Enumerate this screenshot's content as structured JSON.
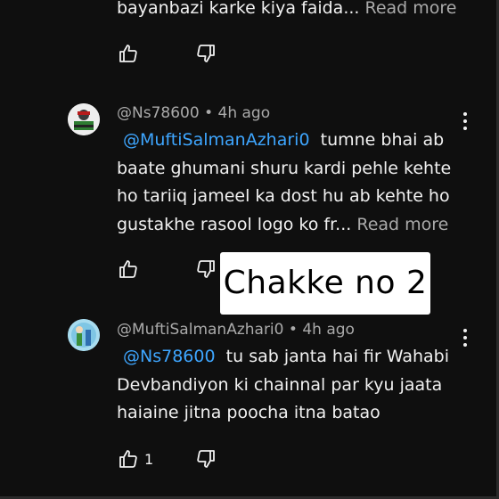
{
  "comment_top": {
    "text": "bayanbazi karke kiya faida...",
    "read_more": "Read more"
  },
  "comment_1": {
    "author": "@Ns78600",
    "time": "4h ago",
    "mention": "@MuftiSalmanAzhari0",
    "line1": "tumne bhai ab",
    "line2": "baate ghumani shuru kardi pehle kehte",
    "line3": "ho tariiq jameel ka dost hu ab kehte ho",
    "line4": "gustakhe rasool logo ko fr...",
    "read_more": "Read more"
  },
  "overlay_caption": "Chakke no 2",
  "comment_2": {
    "author": "@MuftiSalmanAzhari0",
    "time": "4h ago",
    "mention": "@Ns78600",
    "line1": "tu sab janta hai fir Wahabi",
    "line2": "Devbandiyon ki chainnal par kyu jaata",
    "line3": "haiaine jitna poocha itna batao",
    "like_count": "1"
  },
  "meta_separator": "•",
  "icons": [
    "thumbs-up-icon",
    "thumbs-down-icon",
    "more-vert-icon",
    "avatar"
  ],
  "colors": {
    "background": "#0f0f0f",
    "mention": "#3ea6ff",
    "secondary_text": "#aaaaaa"
  }
}
